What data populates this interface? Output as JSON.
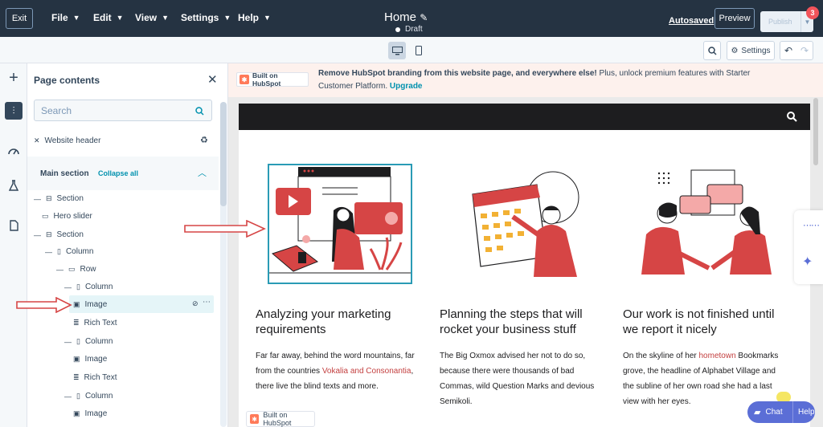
{
  "topbar": {
    "exit_label": "Exit",
    "menus": [
      "File",
      "Edit",
      "View",
      "Settings",
      "Help"
    ],
    "page_title": "Home",
    "status": "Draft",
    "autosaved": "Autosaved",
    "preview_label": "Preview",
    "publish_label": "Publish",
    "notification_count": "3"
  },
  "toolbar": {
    "settings_label": "Settings"
  },
  "panel": {
    "title": "Page contents",
    "search_placeholder": "Search",
    "website_header": "Website header",
    "main_section": "Main section",
    "collapse_all": "Collapse all",
    "tree": [
      {
        "label": "Section",
        "icon": "section-icon"
      },
      {
        "label": "Hero slider",
        "icon": "monitor-icon"
      },
      {
        "label": "Section",
        "icon": "section-icon"
      },
      {
        "label": "Column",
        "icon": "column-icon"
      },
      {
        "label": "Row",
        "icon": "row-icon"
      },
      {
        "label": "Column",
        "icon": "column-icon"
      },
      {
        "label": "Image",
        "icon": "image-icon"
      },
      {
        "label": "Rich Text",
        "icon": "rich-text-icon"
      },
      {
        "label": "Column",
        "icon": "column-icon"
      },
      {
        "label": "Image",
        "icon": "image-icon"
      },
      {
        "label": "Rich Text",
        "icon": "rich-text-icon"
      },
      {
        "label": "Column",
        "icon": "column-icon"
      },
      {
        "label": "Image",
        "icon": "image-icon"
      }
    ]
  },
  "promo": {
    "badge": "Built on HubSpot",
    "bold_text": "Remove HubSpot branding from this website page, and everywhere else!",
    "text": " Plus, unlock premium features with Starter Customer Platform.",
    "link": "Upgrade"
  },
  "columns": [
    {
      "title": "Analyzing your marketing requirements",
      "text_before": "Far far away, behind the word mountains, far from the countries ",
      "highlight": "Vokalia and Consonantia",
      "text_after": ", there live the blind texts and more."
    },
    {
      "title": "Planning the steps that will rocket your business stuff",
      "text_before": "The Big Oxmox advised her not to do so, because there were thousands of bad Commas, wild Question Marks and devious Semikoli.",
      "highlight": "",
      "text_after": ""
    },
    {
      "title": "Our work is not finished until we report it nicely",
      "text_before": "On the skyline of her ",
      "highlight": "hometown",
      "text_after": " Bookmarks grove, the headline of Alphabet Village and the subline of her own road she had a last view with her eyes."
    }
  ],
  "bottom_badge": "Built on HubSpot",
  "chat": {
    "chat_label": "Chat",
    "help_label": "Help"
  },
  "colors": {
    "topbar": "#253342",
    "accent": "#f2545b",
    "link": "#0091ae",
    "illustration_red": "#d64545",
    "chat": "#5b6ed6"
  }
}
